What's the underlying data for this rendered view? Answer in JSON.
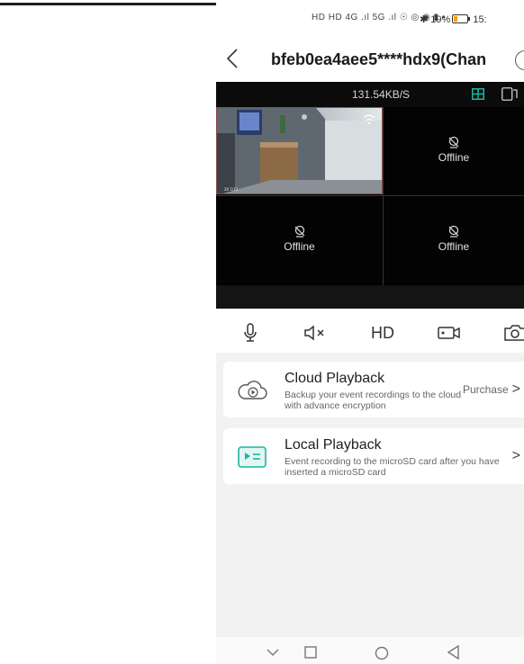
{
  "status_bar": {
    "left_icons": "HD HD 4G .ıl 5G .ıl ☉ ◎ ◉ ▮ ▪",
    "bluetooth": "✱",
    "battery_percent": "19%",
    "time": "15:"
  },
  "header": {
    "title": "bfeb0ea4aee5****hdx9(Chan"
  },
  "video": {
    "speed": "131.54KB/S",
    "offline_label": "Offline"
  },
  "controls": {
    "hd_label": "HD"
  },
  "cards": {
    "cloud": {
      "title": "Cloud Playback",
      "description": "Backup your event recordings to the cloud with advance encryption",
      "action": "Purchase"
    },
    "local": {
      "title": "Local Playback",
      "description": "Event recording to the microSD card after you have inserted a microSD card"
    }
  },
  "colors": {
    "video_bg": "#000000",
    "toolbar_bg": "#0b0b0b",
    "accent_teal": "#18b8a2",
    "battery": "#f2a100",
    "page_bg": "#f2f2f2"
  }
}
